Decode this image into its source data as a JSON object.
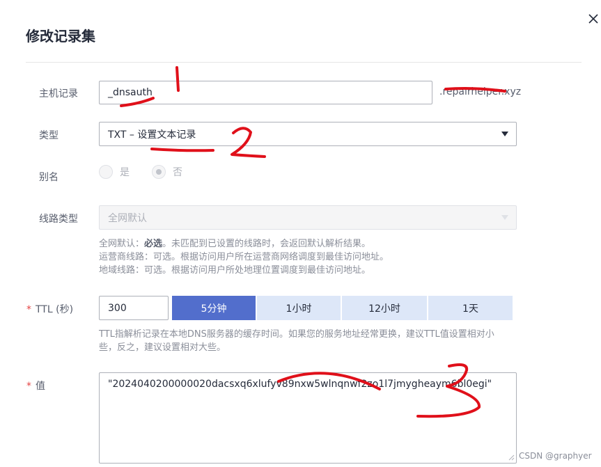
{
  "dialog": {
    "title": "修改记录集",
    "close_icon": "close-icon"
  },
  "form": {
    "host": {
      "label": "主机记录",
      "value": "_dnsauth",
      "suffix": ".repairhelper.xyz"
    },
    "type": {
      "label": "类型",
      "value": "TXT – 设置文本记录"
    },
    "alias": {
      "label": "别名",
      "options": [
        "是",
        "否"
      ],
      "selected": "否"
    },
    "line_type": {
      "label": "线路类型",
      "value": "全网默认",
      "help": {
        "l1_prefix": "全网默认：",
        "l1_bold": "必选",
        "l1_rest": "。未匹配到已设置的线路时，会返回默认解析结果。",
        "l2": "运营商线路：可选。根据访问用户所在运营商网络调度到最佳访问地址。",
        "l3": "地域线路：可选。根据访问用户所处地理位置调度到最佳访问地址。"
      }
    },
    "ttl": {
      "required_mark": "*",
      "label": "TTL (秒)",
      "value": "300",
      "options": [
        "5分钟",
        "1小时",
        "12小时",
        "1天"
      ],
      "selected": "5分钟",
      "help_l1": "TTL指解析记录在本地DNS服务器的缓存时间。如果您的服务地址经常更换，建议TTL值设置相对小",
      "help_l2": "些，反之，建议设置相对大些。"
    },
    "value": {
      "required_mark": "*",
      "label": "值",
      "content": "\"2024040200000020dacsxq6xlufyv89nxw5wlnqnwf2zo1l7jmygheaym6bl0egi\""
    }
  },
  "watermark": "CSDN @graphyer",
  "colors": {
    "primary": "#526ecc",
    "ttl_option_bg": "#dde7f8",
    "required": "#e54545",
    "annotation": "#e0101a"
  }
}
